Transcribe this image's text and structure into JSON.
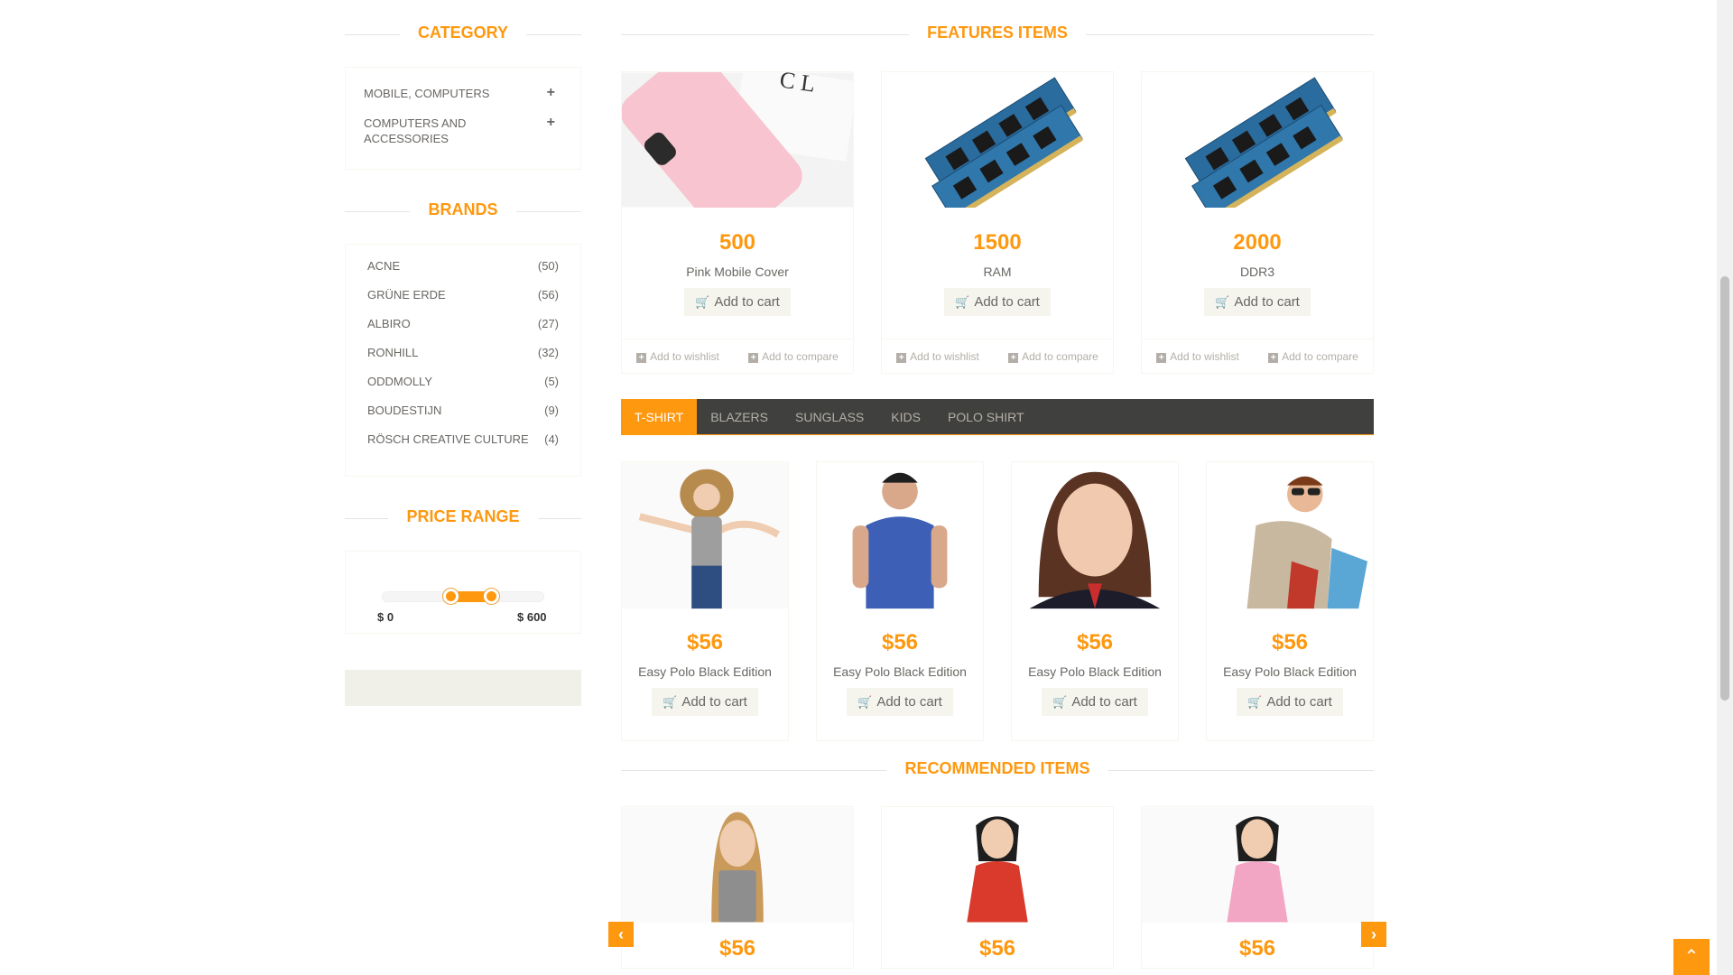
{
  "sidebar": {
    "category_title": "CATEGORY",
    "categories": [
      {
        "label": "MOBILE, COMPUTERS"
      },
      {
        "label": "COMPUTERS AND ACCESSORIES"
      }
    ],
    "brands_title": "BRANDS",
    "brands": [
      {
        "name": "ACNE",
        "count": "(50)"
      },
      {
        "name": "GRÜNE ERDE",
        "count": "(56)"
      },
      {
        "name": "ALBIRO",
        "count": "(27)"
      },
      {
        "name": "RONHILL",
        "count": "(32)"
      },
      {
        "name": "ODDMOLLY",
        "count": "(5)"
      },
      {
        "name": "BOUDESTIJN",
        "count": "(9)"
      },
      {
        "name": "RÖSCH CREATIVE CULTURE",
        "count": "(4)"
      }
    ],
    "price_title": "PRICE RANGE",
    "price_min": "$ 0",
    "price_max": "$ 600"
  },
  "features": {
    "title": "FEATURES ITEMS",
    "items": [
      {
        "price": "500",
        "name": "Pink Mobile Cover",
        "cart": "Add to cart",
        "wishlist": "Add to wishlist",
        "compare": "Add to compare"
      },
      {
        "price": "1500",
        "name": "RAM",
        "cart": "Add to cart",
        "wishlist": "Add to wishlist",
        "compare": "Add to compare"
      },
      {
        "price": "2000",
        "name": "DDR3",
        "cart": "Add to cart",
        "wishlist": "Add to wishlist",
        "compare": "Add to compare"
      }
    ]
  },
  "tabs": [
    "T-SHIRT",
    "BLAZERS",
    "SUNGLASS",
    "KIDS",
    "POLO SHIRT"
  ],
  "tab_items": [
    {
      "price": "$56",
      "name": "Easy Polo Black Edition",
      "cart": "Add to cart"
    },
    {
      "price": "$56",
      "name": "Easy Polo Black Edition",
      "cart": "Add to cart"
    },
    {
      "price": "$56",
      "name": "Easy Polo Black Edition",
      "cart": "Add to cart"
    },
    {
      "price": "$56",
      "name": "Easy Polo Black Edition",
      "cart": "Add to cart"
    }
  ],
  "recommended": {
    "title": "RECOMMENDED ITEMS",
    "items": [
      {
        "price": "$56"
      },
      {
        "price": "$56"
      },
      {
        "price": "$56"
      }
    ]
  },
  "icons": {
    "plus": "+",
    "cart": "🛒",
    "wishlist": "+",
    "prev": "‹",
    "next": "›",
    "up": "⌃"
  },
  "colors": {
    "accent": "#FE980F",
    "tabbar": "#40403E"
  }
}
